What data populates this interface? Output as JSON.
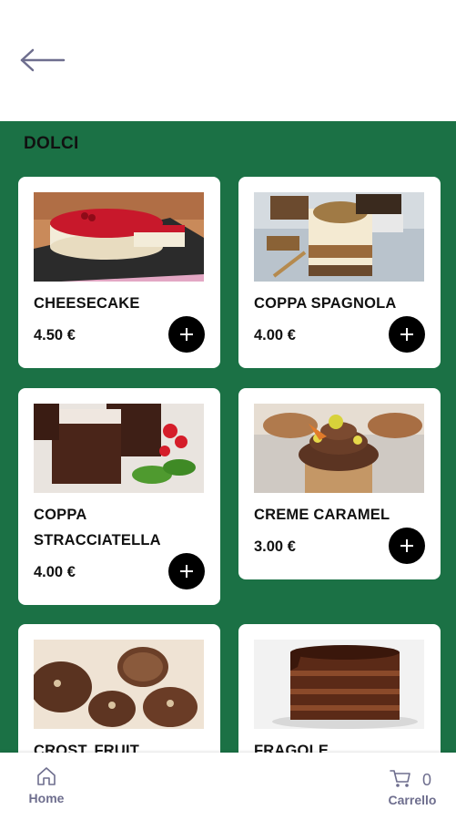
{
  "section": {
    "title": "DOLCI"
  },
  "products": [
    {
      "name": "CHEESECAKE",
      "price": "4.50 €",
      "image": "cheesecake-photo"
    },
    {
      "name": "COPPA SPAGNOLA",
      "price": "4.00 €",
      "image": "coppa-spagnola-photo"
    },
    {
      "name": "COPPA STRACCIATELLA",
      "price": "4.00 €",
      "image": "brownie-photo"
    },
    {
      "name": "CREME CARAMEL",
      "price": "3.00 €",
      "image": "cupcake-photo"
    },
    {
      "name": "CROST. FRUIT",
      "price": "",
      "image": "salame-cioccolato-photo"
    },
    {
      "name": "FRAGOLE",
      "price": "",
      "image": "chocolate-cake-photo"
    }
  ],
  "nav": {
    "home_label": "Home",
    "cart_label": "Carrello",
    "cart_count": "0"
  },
  "icons": {
    "back": "arrow-left-icon",
    "add": "plus-icon",
    "home": "home-icon",
    "cart": "cart-icon"
  },
  "colors": {
    "background": "#1b7145",
    "card": "#ffffff",
    "add_button": "#000000",
    "nav_text": "#6e6e8e"
  }
}
